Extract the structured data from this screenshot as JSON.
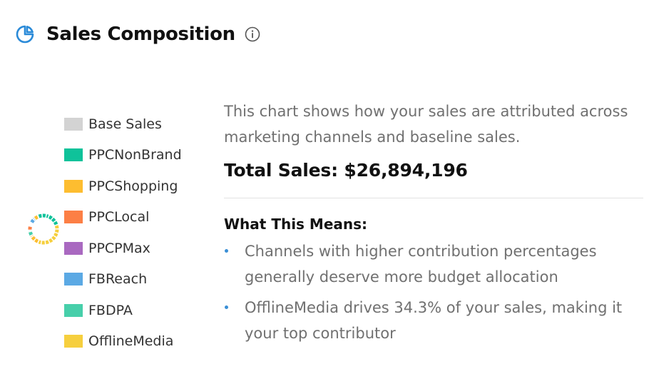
{
  "header": {
    "title": "Sales Composition",
    "icon": "pie-chart-icon",
    "info_icon": "info-icon",
    "accent_color": "#2a8ad8"
  },
  "legend": {
    "items": [
      {
        "label": "Base Sales",
        "color": "#d3d3d3"
      },
      {
        "label": "PPCNonBrand",
        "color": "#0fc29a"
      },
      {
        "label": "PPCShopping",
        "color": "#fdbd30"
      },
      {
        "label": "PPCLocal",
        "color": "#fc7f45"
      },
      {
        "label": "PPCPMax",
        "color": "#a969c0"
      },
      {
        "label": "FBReach",
        "color": "#5ba9e4"
      },
      {
        "label": "FBDPA",
        "color": "#47cfaa"
      },
      {
        "label": "OfflineMedia",
        "color": "#f6cf3e"
      }
    ]
  },
  "summary": {
    "description": "This chart shows how your sales are attributed across marketing channels and baseline sales.",
    "total_sales": "Total Sales: $26,894,196",
    "means_heading": "What This Means:",
    "bullets": [
      "Channels with higher contribution percentages generally deserve more budget allocation",
      "OfflineMedia drives 34.3% of your sales, making it your top contributor"
    ]
  }
}
